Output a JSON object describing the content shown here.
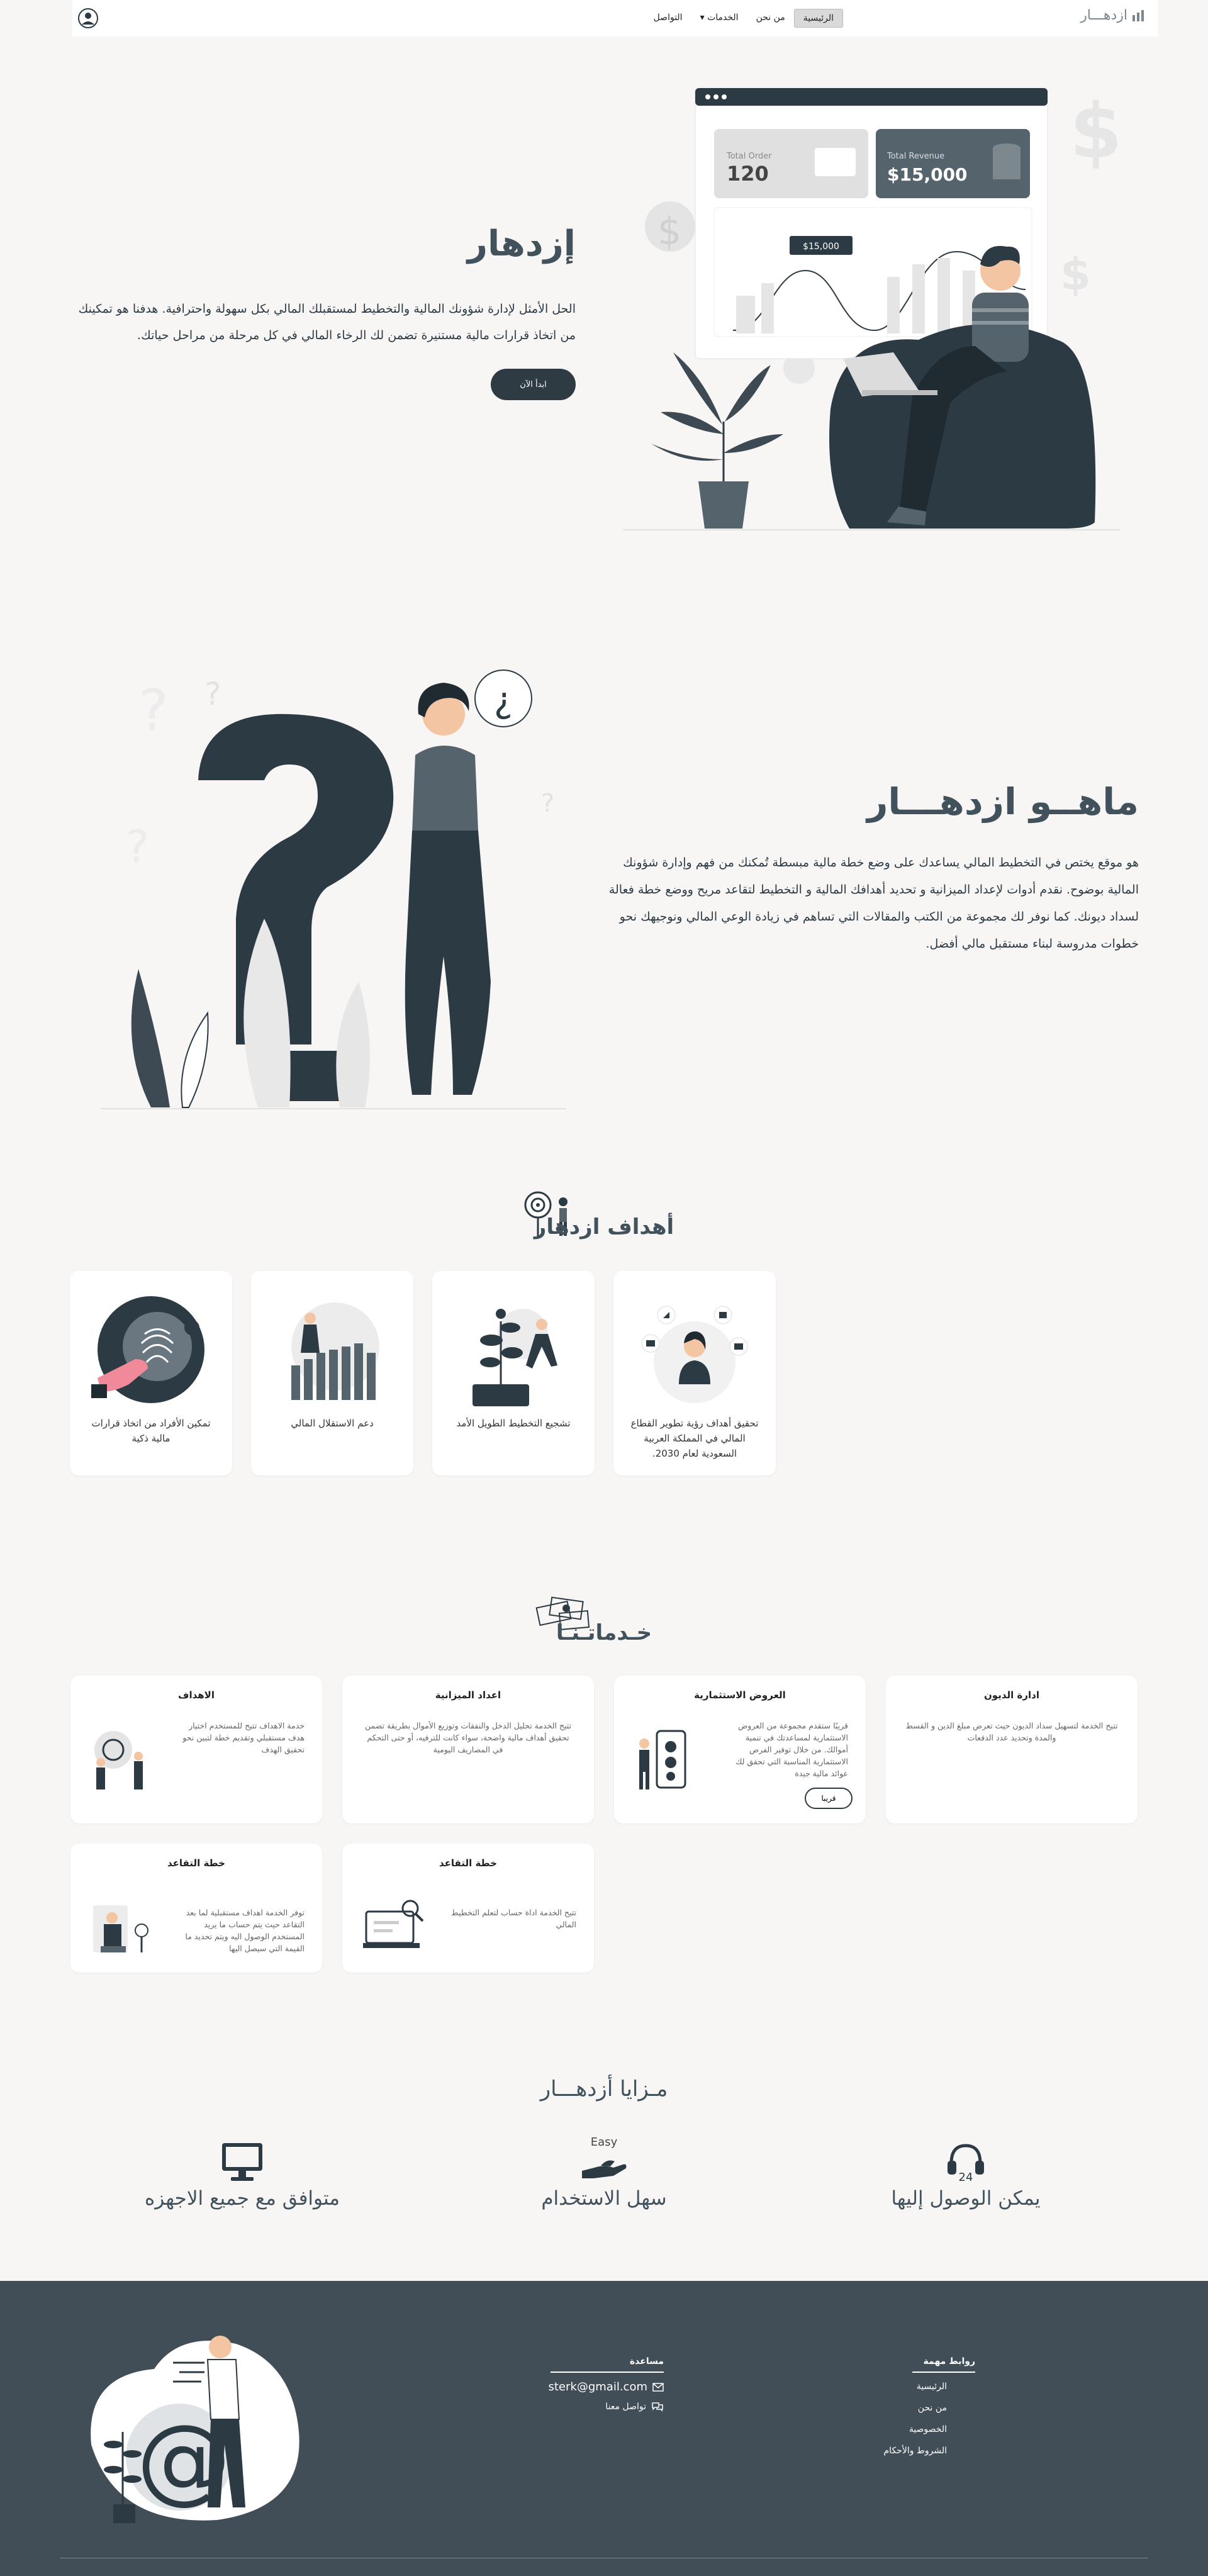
{
  "nav": {
    "brand": "ازدهـــار",
    "links": [
      "الرئيسية",
      "من نحن",
      "الخدمات",
      "التواصل"
    ]
  },
  "hero": {
    "title": "إزدهار",
    "description": "الحل الأمثل لإدارة شؤونك المالية والتخطيط لمستقبلك المالي بكل سهولة واحترافية. هدفنا هو تمكينك من اتخاذ قرارات مالية مستنيرة تضمن لك الرخاء المالي في كل مرحلة من مراحل حياتك.",
    "button": "ابدأ الآن",
    "dashboard": {
      "order_label": "Total Order",
      "order_value": "120",
      "revenue_label": "Total Revenue",
      "revenue_value": "$15,000",
      "tooltip": "$15,000"
    }
  },
  "about": {
    "title": "ماهــو ازدهـــار",
    "description": "هو موقع يختص في التخطيط المالي يساعدك على وضع خطة مالية مبسطة تُمكنك من فهم وإدارة شؤونك المالية بوضوح. نقدم أدوات لإعداد الميزانية و تحديد أهدافك المالية و التخطيط لتقاعد مريح ووضع خطة فعالة لسداد ديونك. كما نوفر لك مجموعة من الكتب والمقالات التي تساهم في زيادة الوعي المالي ونوجيهك نحو خطوات مدروسة لبناء مستقبل مالي أفضل."
  },
  "goals": {
    "title": "أهداف ازدهار",
    "items": [
      "تحقيق أهداف رؤية تطوير القطاع المالي في المملكة العربية السعودية لعام 2030.",
      "تشجيع التخطيط الطويل الأمد",
      "دعم الاستقلال المالي",
      "تمكين الأفراد من اتخاذ قرارات مالية ذكية"
    ]
  },
  "services": {
    "title": "خـدماتـنـا",
    "items": [
      {
        "title": "ادارة الديون",
        "desc": "تتيح الخدمة لتسهيل سداد الديون حيث تعرض مبلغ الدين و القسط والمدة وتحديد عدد الدفعات"
      },
      {
        "title": "العروض الاستثمارية",
        "desc": "قريبًا ستقدم مجموعة من العروض الاستثمارية لمساعدتك في تنمية أموالك. من خلال توفير الفرص الاستثمارية المناسبة التي تحقق لك عوائد مالية جيدة",
        "button": "قريبا"
      },
      {
        "title": "اعداد الميزانية",
        "desc": "تتيح الخدمة تحليل الدخل والنفقات وتوزيع الأموال بطريقة تضمن تحقيق أهداف مالية واضحة، سواء كانت للترفيه، أو حتى التحكم في المصاريف اليومية"
      },
      {
        "title": "الاهداف",
        "desc": "خدمة الاهداف تتيح للمستخدم اختيار هدف مستقبلي وتقديم خطة لتبين نحو تحقيق الهدف"
      },
      {
        "title": "خطة التقاعد",
        "desc": "تتيح الخدمة اداة حساب لتعلم التخطيط المالي"
      },
      {
        "title": "خطة التقاعد",
        "desc": "توفر الخدمة اهداف مستقبلية لما بعد التقاعد حيث يتم حساب ما يريد المستخدم الوصول اليه ويتم تحديد ما القيمة التي سيصل اليها"
      }
    ]
  },
  "features": {
    "title": "مـزايا أزدهـــار",
    "items": [
      {
        "label": "يمكن الوصول إليها",
        "icon": "headset-icon",
        "badge": "24"
      },
      {
        "label": "سهل الاستخدام",
        "icon": "hand-icon",
        "badge": "Easy"
      },
      {
        "label": "متوافق مع جميع الاجهزه",
        "icon": "monitor-icon"
      }
    ]
  },
  "footer": {
    "links_title": "روابط مهمة",
    "links": [
      "الرئيسية",
      "من نحن",
      "الخصوصية",
      "الشروط والأحكام"
    ],
    "help_title": "مساعدة",
    "email": "sterk@gmail.com",
    "contact": "تواصل معنا"
  }
}
